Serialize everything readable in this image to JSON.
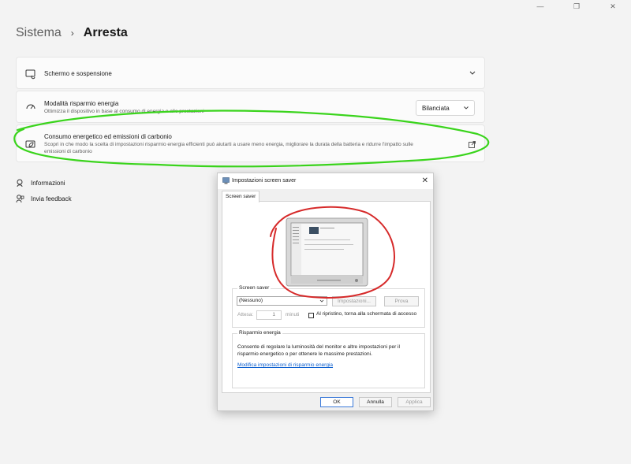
{
  "window": {
    "controls": [
      "minimize",
      "maximize",
      "close"
    ]
  },
  "breadcrumb": {
    "parent": "Sistema",
    "separator": "›",
    "current": "Arresta"
  },
  "settings": {
    "schermo": {
      "title": "Schermo e sospensione",
      "icon": "monitor-sleep-icon"
    },
    "modalita": {
      "title": "Modalità risparmio energia",
      "subtitle": "Ottimizza il dispositivo in base al consumo di energia e alle prestazioni",
      "selected": "Bilanciata",
      "icon": "power-mode-icon"
    },
    "consumo": {
      "title": "Consumo energetico ed emissioni di carbonio",
      "subtitle_line1": "Scopri in che modo la scelta di impostazioni risparmio energia efficienti può aiutarti a usare meno energia, migliorare la durata della batteria e ridurre l'impatto sulle",
      "subtitle_line2": "emissioni di carbonio",
      "icon": "leaf-power-icon"
    }
  },
  "links": {
    "info": "Informazioni",
    "feedback": "Invia feedback"
  },
  "dialog": {
    "title": "Impostazioni screen saver",
    "tab": "Screen saver",
    "screen_saver_group": "Screen saver",
    "selected_saver": "(Nessuno)",
    "settings_button": "Impostazioni...",
    "preview_button": "Prova",
    "wait_label": "Attesa:",
    "wait_value": "1",
    "minutes_label": "minuti",
    "resume_label": "Al ripristino, torna alla schermata di accesso",
    "power_group": "Risparmio energia",
    "power_text": "Consente di regolare la luminosità del monitor e altre impostazioni per il risparmio energetico o per ottenere le massime prestazioni.",
    "power_link": "Modifica impostazioni di risparmio energia",
    "ok": "OK",
    "cancel": "Annulla",
    "apply": "Applica"
  },
  "colors": {
    "annotation_green": "#3ad41c",
    "annotation_red": "#d62a2a",
    "link_blue": "#0b5ecf",
    "focus_blue": "#3b7ad9"
  }
}
